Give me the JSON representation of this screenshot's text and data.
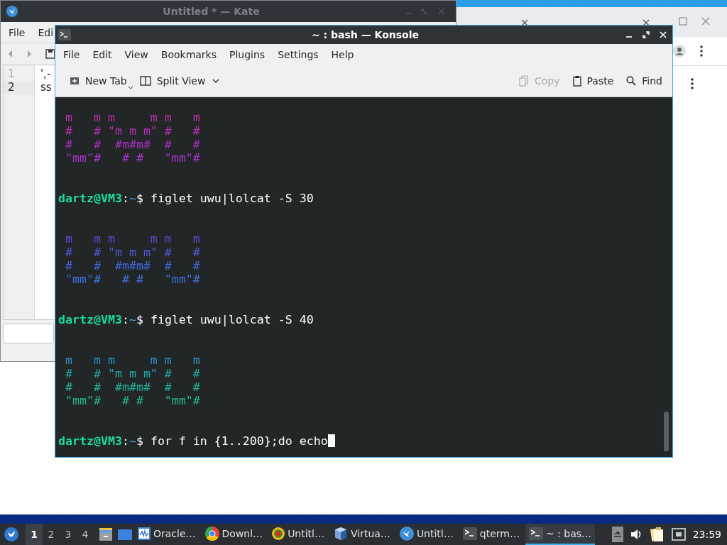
{
  "kate": {
    "title": "Untitled * — Kate",
    "menu": [
      "File",
      "Edi"
    ],
    "lines": [
      {
        "number": "1",
        "text": "',-",
        "current": false
      },
      {
        "number": "2",
        "text": "ss",
        "current": true
      }
    ]
  },
  "konsole": {
    "title": "~ : bash — Konsole",
    "menu": [
      "File",
      "Edit",
      "View",
      "Bookmarks",
      "Plugins",
      "Settings",
      "Help"
    ],
    "toolbar_left": [
      {
        "label": "New Tab",
        "kind": "new-tab"
      },
      {
        "label": "Split View",
        "kind": "split-view"
      }
    ],
    "toolbar_right": [
      {
        "label": "Copy",
        "kind": "copy",
        "disabled": true
      },
      {
        "label": "Paste",
        "kind": "paste",
        "disabled": false
      },
      {
        "label": "Find",
        "kind": "find",
        "disabled": false
      }
    ],
    "terminal": {
      "lines": [
        {
          "kind": "art",
          "text": "m   m m     m m   m",
          "color": "#b8309e"
        },
        {
          "kind": "art",
          "text": "#   # \"m m m\" #   #",
          "color": "#b030b0"
        },
        {
          "kind": "art",
          "text": "#   #  #m#m#  #   #",
          "color": "#a830c0"
        },
        {
          "kind": "art",
          "text": "\"mm\"#   # #   \"mm\"#",
          "color": "#a034c8"
        },
        {
          "kind": "blank"
        },
        {
          "kind": "blank"
        },
        {
          "kind": "prompt",
          "user": "dartz@VM3",
          "sep": ":",
          "path": "~",
          "symbol": "$",
          "command": "figlet uwu|lolcat -S 30",
          "cursor": false
        },
        {
          "kind": "blank"
        },
        {
          "kind": "blank"
        },
        {
          "kind": "art",
          "text": "m   m m     m m   m",
          "color": "#5a48d0"
        },
        {
          "kind": "art",
          "text": "#   # \"m m m\" #   #",
          "color": "#4c58d8"
        },
        {
          "kind": "art",
          "text": "#   #  #m#m#  #   #",
          "color": "#4066d8"
        },
        {
          "kind": "art",
          "text": "\"mm\"#   # #   \"mm\"#",
          "color": "#3a70d8"
        },
        {
          "kind": "blank"
        },
        {
          "kind": "blank"
        },
        {
          "kind": "prompt",
          "user": "dartz@VM3",
          "sep": ":",
          "path": "~",
          "symbol": "$",
          "command": "figlet uwu|lolcat -S 40",
          "cursor": false
        },
        {
          "kind": "blank"
        },
        {
          "kind": "blank"
        },
        {
          "kind": "art",
          "text": "m   m m     m m   m",
          "color": "#2a8ec0"
        },
        {
          "kind": "art",
          "text": "#   # \"m m m\" #   #",
          "color": "#24a4a8"
        },
        {
          "kind": "art",
          "text": "#   #  #m#m#  #   #",
          "color": "#20ae98"
        },
        {
          "kind": "art",
          "text": "\"mm\"#   # #   \"mm\"#",
          "color": "#22b490"
        },
        {
          "kind": "blank"
        },
        {
          "kind": "blank"
        },
        {
          "kind": "prompt",
          "user": "dartz@VM3",
          "sep": ":",
          "path": "~",
          "symbol": "$",
          "command": "for f in {1..200};do echo",
          "cursor": true
        }
      ]
    }
  },
  "taskbar": {
    "workspaces": [
      {
        "label": "1",
        "selected": true
      },
      {
        "label": "2",
        "selected": false
      },
      {
        "label": "3",
        "selected": false
      },
      {
        "label": "4",
        "selected": false
      }
    ],
    "tasks": [
      {
        "label": "Oracle…",
        "kind": "monitor",
        "selected": false
      },
      {
        "label": "Downl…",
        "kind": "browser",
        "selected": false
      },
      {
        "label": "Untitl…",
        "kind": "target",
        "selected": false
      },
      {
        "label": "Virtua…",
        "kind": "cube",
        "selected": false
      },
      {
        "label": "Untitl…",
        "kind": "bird",
        "selected": false
      },
      {
        "label": "qterm…",
        "kind": "terminal",
        "selected": false
      },
      {
        "label": "~ : bas…",
        "kind": "terminal",
        "selected": true
      }
    ],
    "clock": "23:59"
  }
}
